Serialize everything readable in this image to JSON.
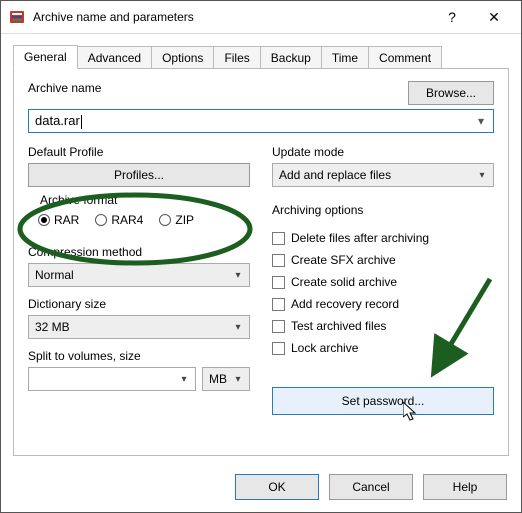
{
  "window": {
    "title": "Archive name and parameters",
    "help_glyph": "?",
    "close_glyph": "✕"
  },
  "tabs": [
    {
      "label": "General",
      "active": true
    },
    {
      "label": "Advanced"
    },
    {
      "label": "Options"
    },
    {
      "label": "Files"
    },
    {
      "label": "Backup"
    },
    {
      "label": "Time"
    },
    {
      "label": "Comment"
    }
  ],
  "archive_name": {
    "label": "Archive name",
    "value": "data.rar",
    "browse_label": "Browse..."
  },
  "left": {
    "default_profile_label": "Default Profile",
    "profiles_button": "Profiles...",
    "archive_format": {
      "legend": "Archive format",
      "options": [
        {
          "label": "RAR",
          "checked": true
        },
        {
          "label": "RAR4",
          "checked": false
        },
        {
          "label": "ZIP",
          "checked": false
        }
      ]
    },
    "compression": {
      "label": "Compression method",
      "value": "Normal"
    },
    "dictionary": {
      "label": "Dictionary size",
      "value": "32 MB"
    },
    "split": {
      "label": "Split to volumes, size",
      "value": "",
      "unit": "MB"
    }
  },
  "right": {
    "update_mode": {
      "label": "Update mode",
      "value": "Add and replace files"
    },
    "options_label": "Archiving options",
    "options": [
      {
        "label": "Delete files after archiving"
      },
      {
        "label": "Create SFX archive"
      },
      {
        "label": "Create solid archive"
      },
      {
        "label": "Add recovery record"
      },
      {
        "label": "Test archived files"
      },
      {
        "label": "Lock archive"
      }
    ],
    "set_password": "Set password..."
  },
  "footer": {
    "ok": "OK",
    "cancel": "Cancel",
    "help": "Help"
  },
  "glyphs": {
    "caret_down": "▾"
  }
}
